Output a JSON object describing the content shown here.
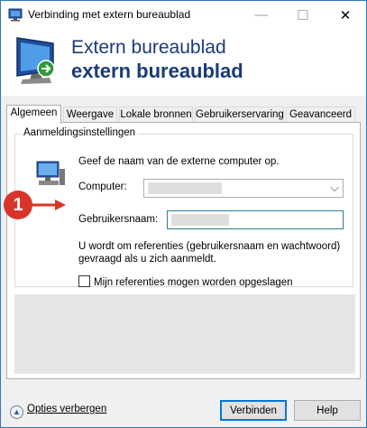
{
  "window": {
    "title": "Verbinding met extern bureaublad",
    "min_glyph": "—",
    "max_glyph": "☐",
    "close_glyph": "✕"
  },
  "banner": {
    "line1": "Extern bureaublad",
    "line2": "extern bureaublad"
  },
  "tabs": [
    {
      "label": "Algemeen",
      "active": true
    },
    {
      "label": "Weergave",
      "active": false
    },
    {
      "label": "Lokale bronnen",
      "active": false
    },
    {
      "label": "Gebruikerservaring",
      "active": false
    },
    {
      "label": "Geavanceerd",
      "active": false
    }
  ],
  "logon": {
    "legend": "Aanmeldingsinstellingen",
    "hint": "Geef de naam van de externe computer op.",
    "computer_label": "Computer:",
    "computer_value": "",
    "username_label": "Gebruikersnaam:",
    "username_value": "",
    "info": "U wordt om referenties (gebruikersnaam en wachtwoord) gevraagd als u zich aanmeldt.",
    "remember_label": "Mijn referenties mogen worden opgeslagen",
    "remember_checked": false
  },
  "callout": {
    "number": "1",
    "color": "#d8352a"
  },
  "footer": {
    "options_label": "Opties verbergen",
    "connect_label": "Verbinden",
    "help_label": "Help"
  },
  "colors": {
    "accent": "#0078d7",
    "banner_text": "#1a3a7a"
  }
}
